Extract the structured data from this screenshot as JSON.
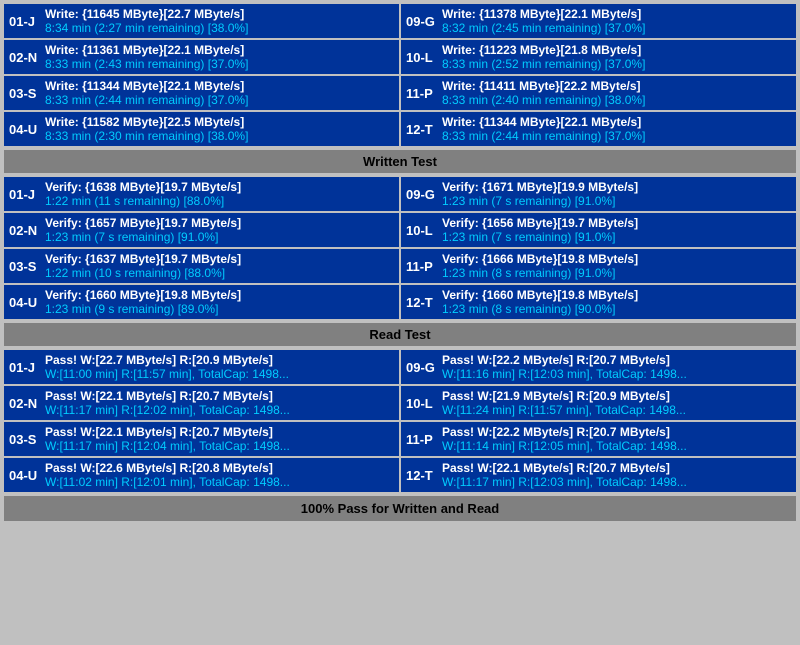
{
  "sections": {
    "write": {
      "label": "Written Test",
      "drives_left": [
        {
          "id": "01-J",
          "line1": "Write: {11645 MByte}[22.7 MByte/s]",
          "line2": "8:34 min (2:27 min remaining)  [38.0%]"
        },
        {
          "id": "02-N",
          "line1": "Write: {11361 MByte}[22.1 MByte/s]",
          "line2": "8:33 min (2:43 min remaining)  [37.0%]"
        },
        {
          "id": "03-S",
          "line1": "Write: {11344 MByte}[22.1 MByte/s]",
          "line2": "8:33 min (2:44 min remaining)  [37.0%]"
        },
        {
          "id": "04-U",
          "line1": "Write: {11582 MByte}[22.5 MByte/s]",
          "line2": "8:33 min (2:30 min remaining)  [38.0%]"
        }
      ],
      "drives_right": [
        {
          "id": "09-G",
          "line1": "Write: {11378 MByte}[22.1 MByte/s]",
          "line2": "8:32 min (2:45 min remaining)  [37.0%]"
        },
        {
          "id": "10-L",
          "line1": "Write: {11223 MByte}[21.8 MByte/s]",
          "line2": "8:33 min (2:52 min remaining)  [37.0%]"
        },
        {
          "id": "11-P",
          "line1": "Write: {11411 MByte}[22.2 MByte/s]",
          "line2": "8:33 min (2:40 min remaining)  [38.0%]"
        },
        {
          "id": "12-T",
          "line1": "Write: {11344 MByte}[22.1 MByte/s]",
          "line2": "8:33 min (2:44 min remaining)  [37.0%]"
        }
      ]
    },
    "verify": {
      "label": "Written Test",
      "drives_left": [
        {
          "id": "01-J",
          "line1": "Verify: {1638 MByte}[19.7 MByte/s]",
          "line2": "1:22 min (11 s remaining)   [88.0%]"
        },
        {
          "id": "02-N",
          "line1": "Verify: {1657 MByte}[19.7 MByte/s]",
          "line2": "1:23 min (7 s remaining)   [91.0%]"
        },
        {
          "id": "03-S",
          "line1": "Verify: {1637 MByte}[19.7 MByte/s]",
          "line2": "1:22 min (10 s remaining)   [88.0%]"
        },
        {
          "id": "04-U",
          "line1": "Verify: {1660 MByte}[19.8 MByte/s]",
          "line2": "1:23 min (9 s remaining)   [89.0%]"
        }
      ],
      "drives_right": [
        {
          "id": "09-G",
          "line1": "Verify: {1671 MByte}[19.9 MByte/s]",
          "line2": "1:23 min (7 s remaining)   [91.0%]"
        },
        {
          "id": "10-L",
          "line1": "Verify: {1656 MByte}[19.7 MByte/s]",
          "line2": "1:23 min (7 s remaining)   [91.0%]"
        },
        {
          "id": "11-P",
          "line1": "Verify: {1666 MByte}[19.8 MByte/s]",
          "line2": "1:23 min (8 s remaining)   [91.0%]"
        },
        {
          "id": "12-T",
          "line1": "Verify: {1660 MByte}[19.8 MByte/s]",
          "line2": "1:23 min (8 s remaining)   [90.0%]"
        }
      ]
    },
    "read": {
      "label": "Read Test",
      "drives_left": [
        {
          "id": "01-J",
          "line1": "Pass! W:[22.7 MByte/s] R:[20.9 MByte/s]",
          "line2": "W:[11:00 min] R:[11:57 min], TotalCap: 1498..."
        },
        {
          "id": "02-N",
          "line1": "Pass! W:[22.1 MByte/s] R:[20.7 MByte/s]",
          "line2": "W:[11:17 min] R:[12:02 min], TotalCap: 1498..."
        },
        {
          "id": "03-S",
          "line1": "Pass! W:[22.1 MByte/s] R:[20.7 MByte/s]",
          "line2": "W:[11:17 min] R:[12:04 min], TotalCap: 1498..."
        },
        {
          "id": "04-U",
          "line1": "Pass! W:[22.6 MByte/s] R:[20.8 MByte/s]",
          "line2": "W:[11:02 min] R:[12:01 min], TotalCap: 1498..."
        }
      ],
      "drives_right": [
        {
          "id": "09-G",
          "line1": "Pass! W:[22.2 MByte/s] R:[20.7 MByte/s]",
          "line2": "W:[11:16 min] R:[12:03 min], TotalCap: 1498..."
        },
        {
          "id": "10-L",
          "line1": "Pass! W:[21.9 MByte/s] R:[20.9 MByte/s]",
          "line2": "W:[11:24 min] R:[11:57 min], TotalCap: 1498..."
        },
        {
          "id": "11-P",
          "line1": "Pass! W:[22.2 MByte/s] R:[20.7 MByte/s]",
          "line2": "W:[11:14 min] R:[12:05 min], TotalCap: 1498..."
        },
        {
          "id": "12-T",
          "line1": "Pass! W:[22.1 MByte/s] R:[20.7 MByte/s]",
          "line2": "W:[11:17 min] R:[12:03 min], TotalCap: 1498..."
        }
      ]
    }
  },
  "labels": {
    "written_test": "Written Test",
    "read_test": "Read Test",
    "footer": "100% Pass for Written and Read"
  }
}
